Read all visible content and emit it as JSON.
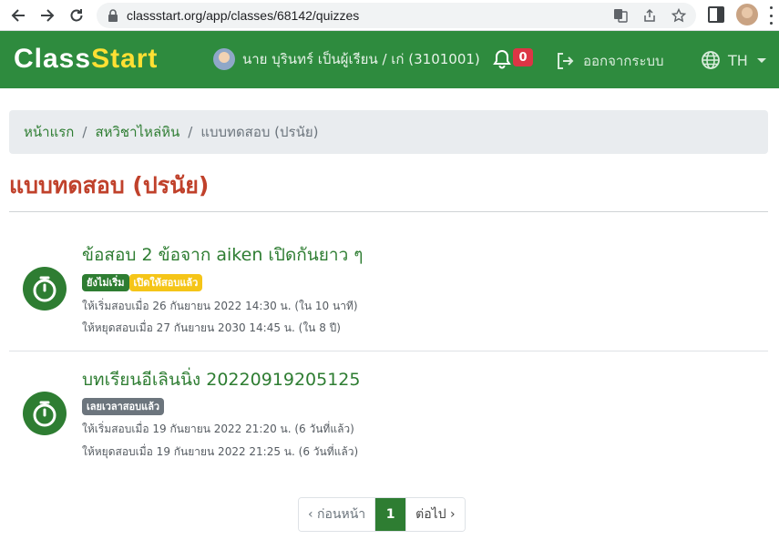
{
  "browser": {
    "url": "classstart.org/app/classes/68142/quizzes"
  },
  "header": {
    "logo_part1": "Class",
    "logo_part2": "Start",
    "user_name": "นาย บุรินทร์ เป็นผู้เรียน / เก่ (3101001)",
    "notification_count": "0",
    "logout_label": "ออกจากระบบ",
    "language": "TH"
  },
  "breadcrumb": {
    "home": "หน้าแรก",
    "course": "สหวิชาไหล่หิน",
    "current": "แบบทดสอบ (ปรนัย)"
  },
  "page": {
    "title": "แบบทดสอบ (ปรนัย)"
  },
  "quizzes": [
    {
      "title": "ข้อสอบ 2 ข้อจาก aiken เปิดกันยาว ๆ",
      "badges": [
        "ยังไม่เริ่ม",
        "เปิดให้สอบแล้ว"
      ],
      "start_line": "ให้เริ่มสอบเมื่อ 26 กันยายน 2022 14:30 น. (ใน 10 นาที)",
      "end_line": "ให้หยุดสอบเมื่อ 27 กันยายน 2030 14:45 น. (ใน 8 ปี)"
    },
    {
      "title": "บทเรียนอีเลินนิ่ง 20220919205125",
      "badges": [
        "เลยเวลาสอบแล้ว"
      ],
      "start_line": "ให้เริ่มสอบเมื่อ 19 กันยายน 2022 21:20 น. (6 วันที่แล้ว)",
      "end_line": "ให้หยุดสอบเมื่อ 19 กันยายน 2022 21:25 น. (6 วันที่แล้ว)"
    }
  ],
  "pagination": {
    "prev": "‹ ก่อนหน้า",
    "current": "1",
    "next": "ต่อไป ›"
  },
  "colors": {
    "brand_green": "#2e8b3e",
    "accent_green": "#2e7d32",
    "title_red": "#c0412b",
    "badge_yellow": "#f5c518",
    "badge_gray": "#6c757d",
    "notification_red": "#dc3545"
  },
  "icons": [
    "back-arrow-icon",
    "forward-arrow-icon",
    "reload-icon",
    "lock-icon",
    "translate-icon",
    "share-icon",
    "star-icon",
    "side-panel-icon",
    "kebab-menu-icon",
    "bell-icon",
    "logout-icon",
    "globe-icon",
    "stopwatch-icon"
  ]
}
